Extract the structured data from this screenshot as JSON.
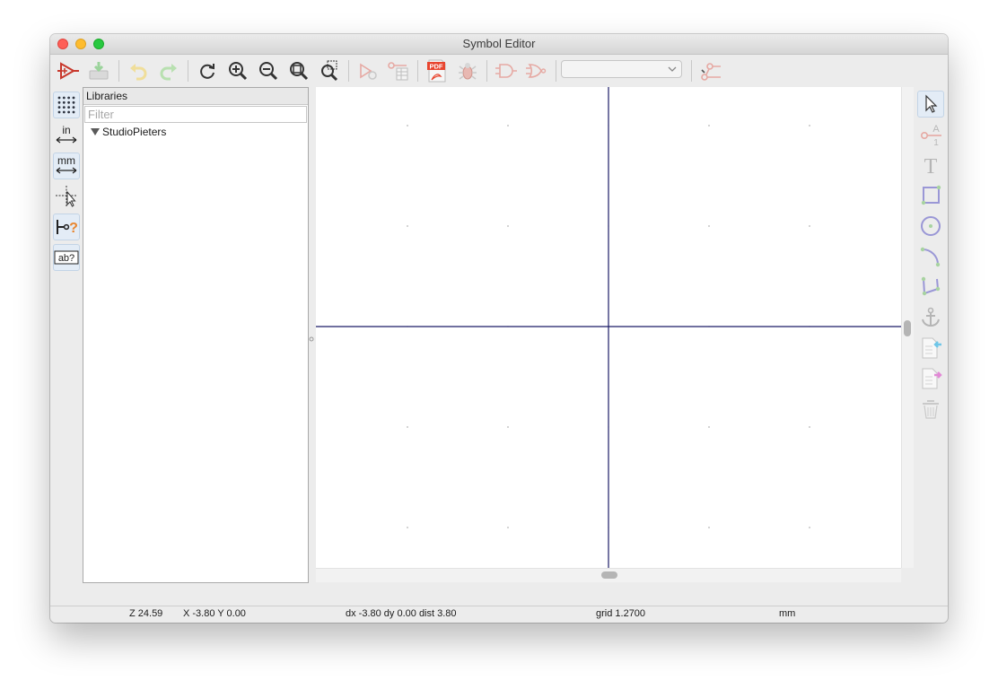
{
  "window": {
    "title": "Symbol Editor"
  },
  "toolbar": {
    "items": [
      {
        "icon": "new-symbol-icon"
      },
      {
        "icon": "save-icon"
      },
      {
        "icon": "undo-icon"
      },
      {
        "icon": "redo-icon"
      },
      {
        "icon": "refresh-icon"
      },
      {
        "icon": "zoom-in-icon"
      },
      {
        "icon": "zoom-out-icon"
      },
      {
        "icon": "zoom-fit-icon"
      },
      {
        "icon": "zoom-selection-icon"
      },
      {
        "icon": "symbol-properties-icon"
      },
      {
        "icon": "pin-table-icon"
      },
      {
        "icon": "export-pdf-icon",
        "text": "PDF"
      },
      {
        "icon": "run-erc-icon"
      },
      {
        "icon": "show-normal-body-icon"
      },
      {
        "icon": "show-de-morgan-body-icon"
      },
      {
        "icon": "unit-selector",
        "value": ""
      },
      {
        "icon": "edit-pin-settings-icon"
      }
    ]
  },
  "left_toolbar": {
    "items": [
      {
        "icon": "grid-toggle-icon",
        "active": true
      },
      {
        "icon": "inches-units-icon",
        "text": "in",
        "active": false
      },
      {
        "icon": "millimeter-units-icon",
        "text": "mm",
        "active": true
      },
      {
        "icon": "full-crosshair-icon",
        "active": false
      },
      {
        "icon": "show-pin-electrical-type-icon",
        "text": "?",
        "active": true
      },
      {
        "icon": "show-hidden-fields-icon",
        "text": "ab?",
        "active": true
      }
    ]
  },
  "libraries": {
    "header": "Libraries",
    "filter_placeholder": "Filter",
    "filter_value": "",
    "items": [
      {
        "label": "StudioPieters",
        "expanded": true
      }
    ]
  },
  "right_toolbar": {
    "items": [
      {
        "icon": "select-arrow-icon",
        "active": true
      },
      {
        "icon": "add-pin-icon",
        "text": "A",
        "subtext": "1"
      },
      {
        "icon": "add-text-icon",
        "text": "T"
      },
      {
        "icon": "add-rectangle-icon"
      },
      {
        "icon": "add-circle-icon"
      },
      {
        "icon": "add-arc-icon"
      },
      {
        "icon": "add-polyline-icon"
      },
      {
        "icon": "anchor-icon"
      },
      {
        "icon": "import-graphics-icon"
      },
      {
        "icon": "export-graphics-icon"
      },
      {
        "icon": "delete-trash-icon"
      }
    ]
  },
  "status_bar": {
    "zoom": "Z 24.59",
    "cursor": "X -3.80  Y 0.00",
    "delta": "dx -3.80  dy 0.00  dist 3.80",
    "grid": "grid 1.2700",
    "units": "mm"
  },
  "colors": {
    "axis": "#1a1a66",
    "grid_dot": "#6a6a6a",
    "canvas_bg": "#ffffff",
    "active_tool_bg": "#e3ecf6",
    "window_bg": "#ececec"
  }
}
